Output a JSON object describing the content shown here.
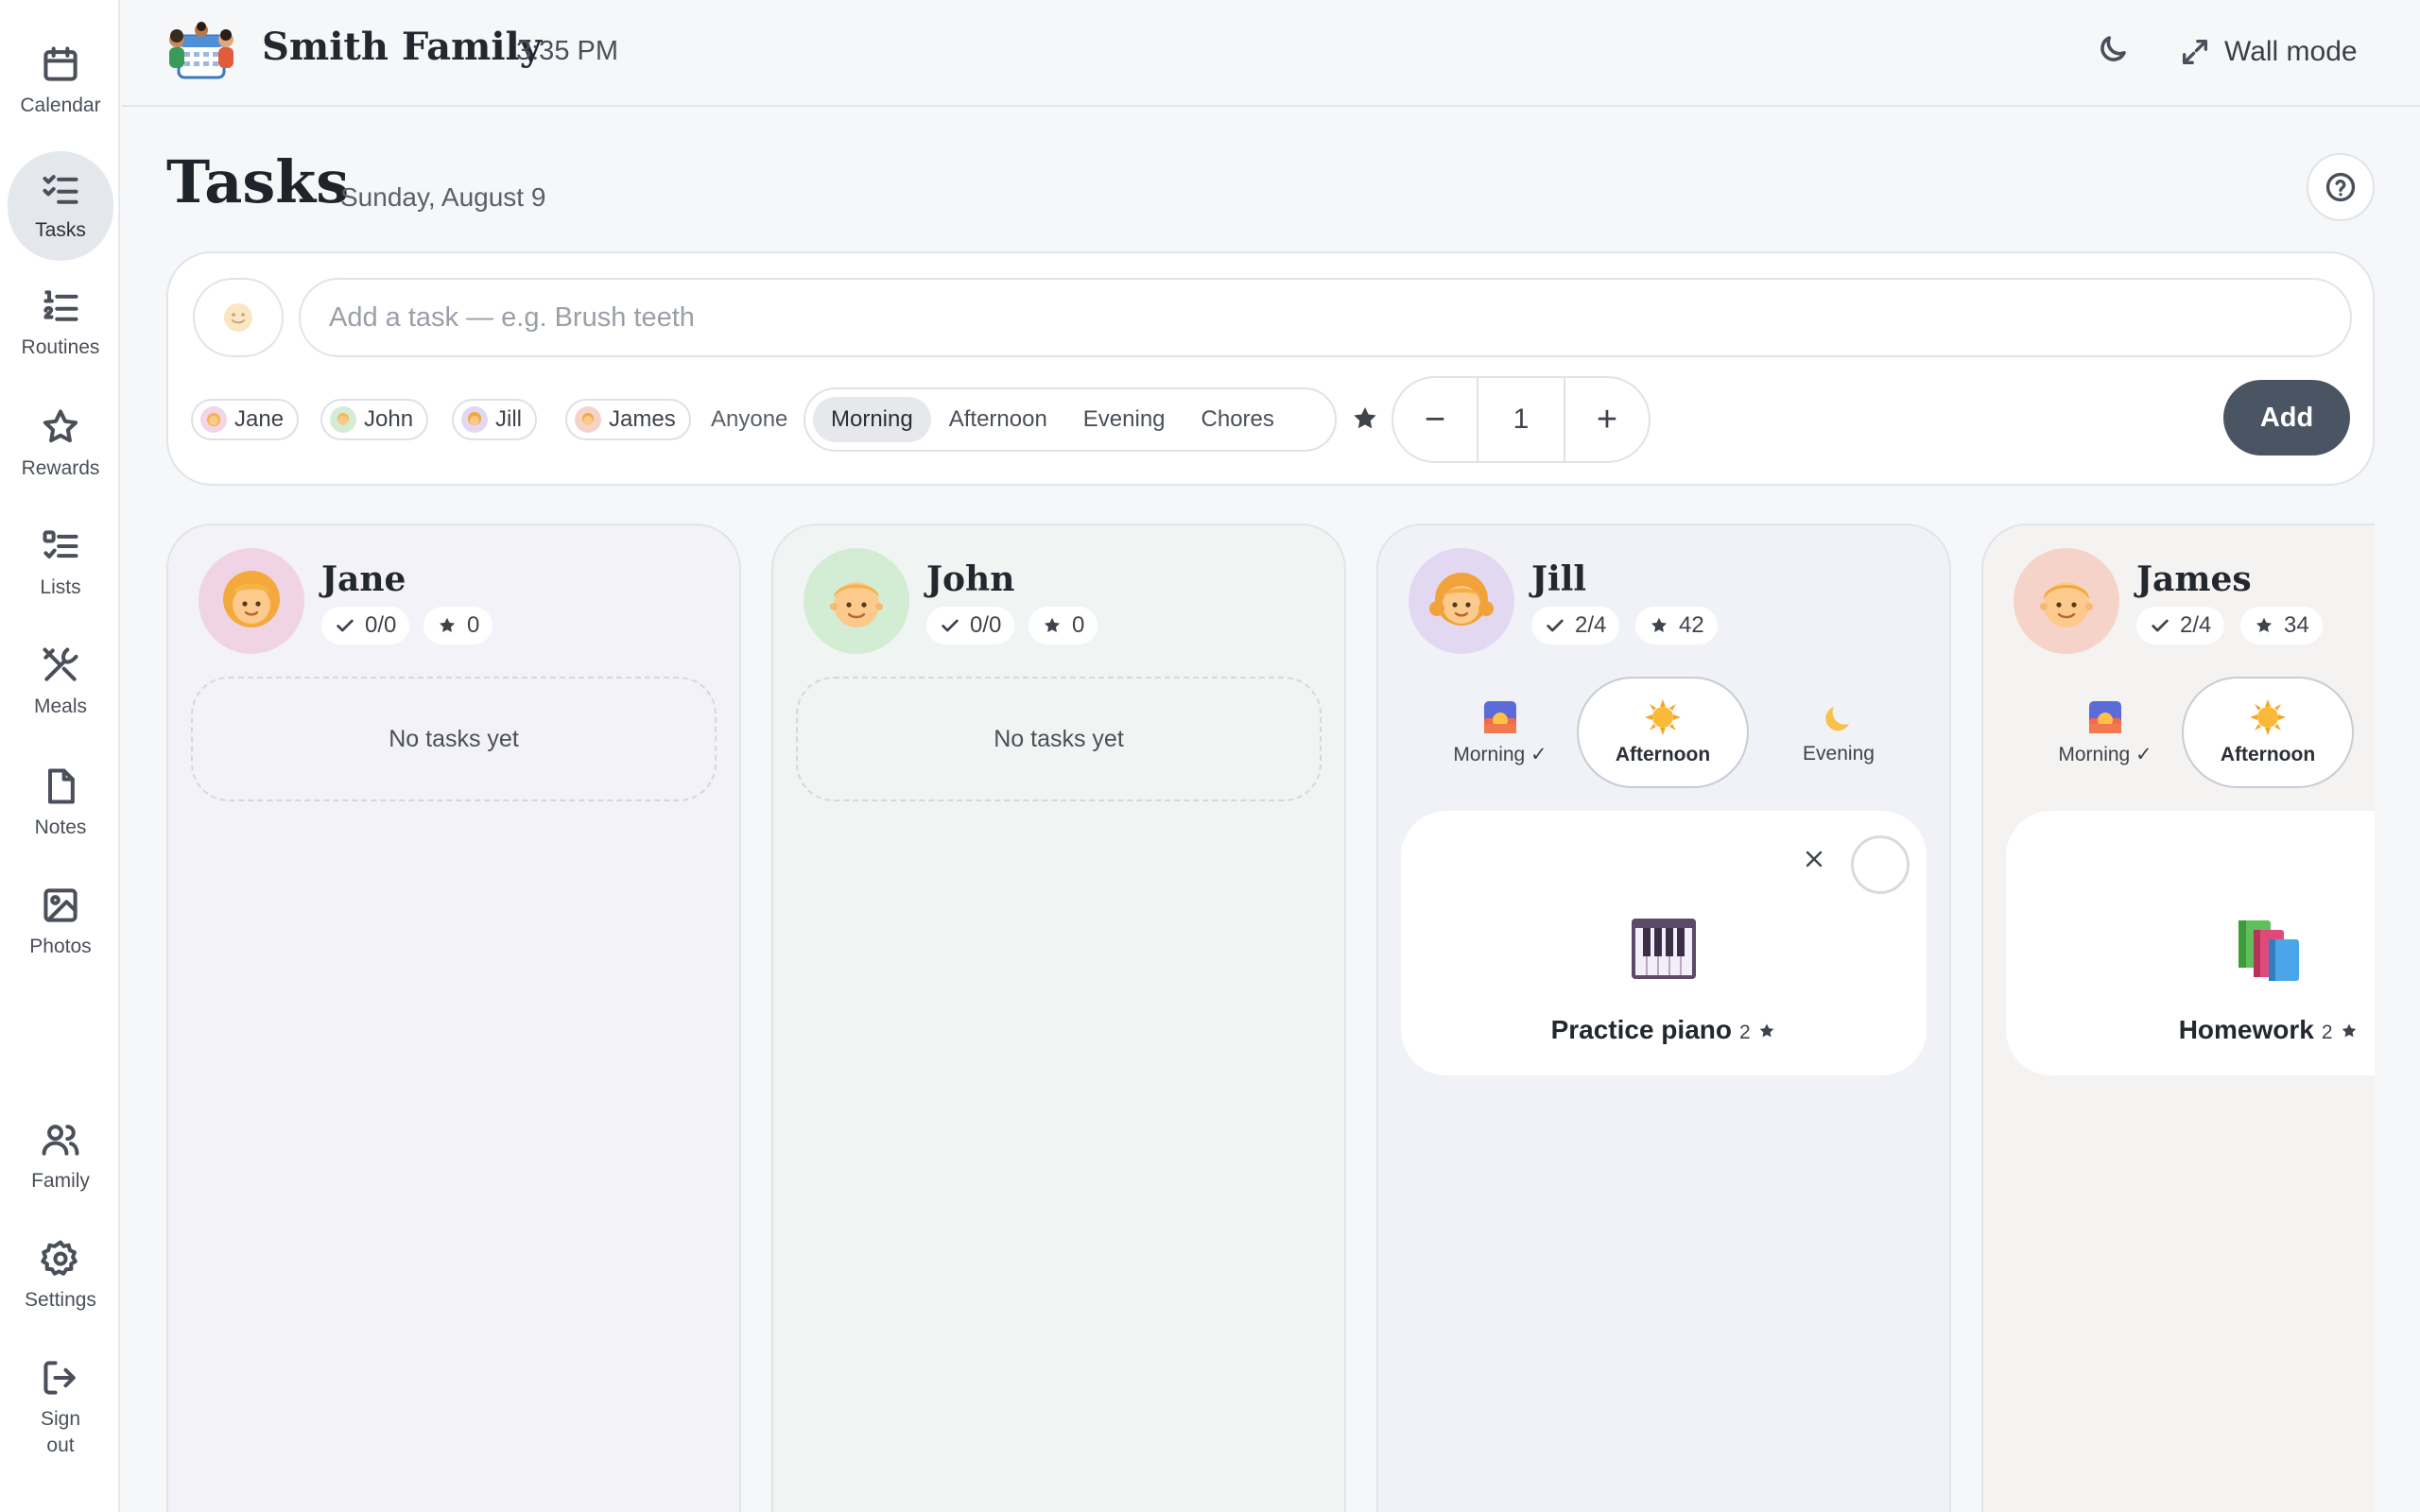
{
  "sidebar": {
    "items": [
      {
        "label": "Calendar"
      },
      {
        "label": "Tasks"
      },
      {
        "label": "Routines"
      },
      {
        "label": "Rewards"
      },
      {
        "label": "Lists"
      },
      {
        "label": "Meals"
      },
      {
        "label": "Notes"
      },
      {
        "label": "Photos"
      }
    ],
    "bottom": [
      {
        "label": "Family"
      },
      {
        "label": "Settings"
      },
      {
        "label": "Sign out"
      }
    ],
    "active": "Tasks"
  },
  "header": {
    "family_name": "Smith Family",
    "time": "3:35 PM",
    "wall_mode_label": "Wall mode"
  },
  "page": {
    "title": "Tasks",
    "date": "Sunday, August 9"
  },
  "add_task": {
    "placeholder": "Add a task — e.g. Brush teeth",
    "people": [
      "Jane",
      "John",
      "Jill",
      "James"
    ],
    "anyone_label": "Anyone",
    "segments": [
      "Morning",
      "Afternoon",
      "Evening",
      "Chores"
    ],
    "selected_segment": "Morning",
    "points": "1",
    "minus": "−",
    "plus": "+",
    "add_label": "Add"
  },
  "columns": [
    {
      "name": "Jane",
      "done": "0/0",
      "stars": "0",
      "empty_text": "No tasks yet",
      "bg": "#f3f2f8",
      "avatar_bg": "#f0d4e6"
    },
    {
      "name": "John",
      "done": "0/0",
      "stars": "0",
      "empty_text": "No tasks yet",
      "bg": "#f0f5f3",
      "avatar_bg": "#d3ecd4"
    },
    {
      "name": "Jill",
      "done": "2/4",
      "stars": "42",
      "bg": "#f1f2f8",
      "avatar_bg": "#e3d8f2",
      "periods": [
        {
          "label": "Morning ✓"
        },
        {
          "label": "Afternoon"
        },
        {
          "label": "Evening"
        }
      ],
      "task": {
        "title": "Practice piano",
        "points": "2"
      }
    },
    {
      "name": "James",
      "done": "2/4",
      "stars": "34",
      "bg": "#f5f2f2",
      "avatar_bg": "#f6d3c8",
      "periods": [
        {
          "label": "Morning ✓"
        },
        {
          "label": "Afternoon"
        }
      ],
      "task": {
        "title": "Homework",
        "points": "2"
      }
    }
  ],
  "colors": {
    "accent": "#4a5564",
    "active_nav": "#e4e7ec"
  }
}
